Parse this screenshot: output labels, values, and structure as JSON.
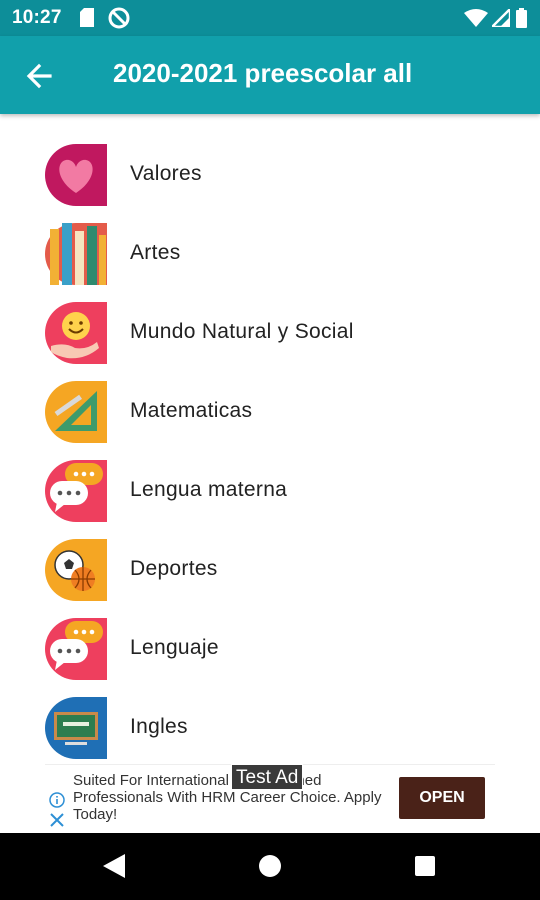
{
  "status_bar": {
    "time": "10:27",
    "icons": [
      "sd-card-icon",
      "no-disturb-icon",
      "wifi-icon",
      "signal-icon",
      "battery-icon"
    ]
  },
  "app_bar": {
    "title": "2020-2021 preescolar all",
    "back_icon": "arrow-back-icon"
  },
  "list": {
    "items": [
      {
        "label": "Valores",
        "icon": "heart-icon"
      },
      {
        "label": "Artes",
        "icon": "art-supplies-icon"
      },
      {
        "label": "Mundo Natural y Social",
        "icon": "smiley-hand-icon"
      },
      {
        "label": "Matematicas",
        "icon": "ruler-triangle-icon"
      },
      {
        "label": "Lengua materna",
        "icon": "chat-bubbles-icon"
      },
      {
        "label": "Deportes",
        "icon": "sports-balls-icon"
      },
      {
        "label": "Lenguaje",
        "icon": "chat-bubbles-icon"
      },
      {
        "label": "Ingles",
        "icon": "english-board-icon"
      }
    ]
  },
  "ad": {
    "text": "Suited For International HRM Trained Professionals With HRM Career Choice. Apply Today!",
    "button_label": "OPEN",
    "test_label": "Test Ad",
    "button_color": "#4a2218"
  },
  "colors": {
    "app_bar": "#11a0ab",
    "status_bar": "#0d8e99"
  }
}
